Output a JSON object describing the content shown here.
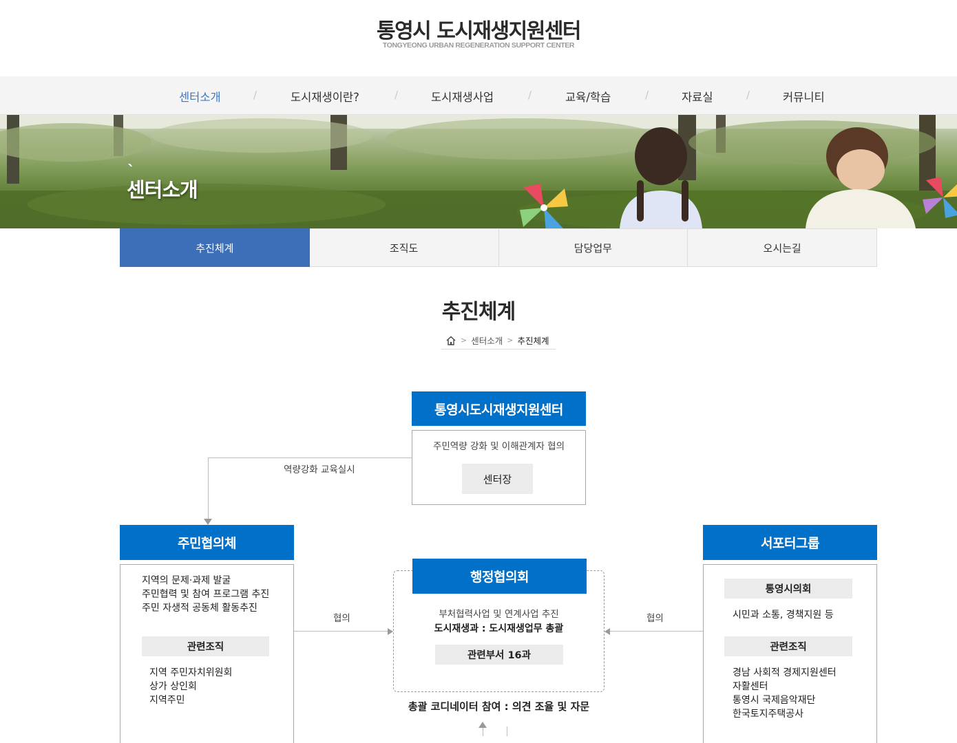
{
  "header": {
    "title": "통영시 도시재생지원센터",
    "subtitle": "TONGYEONG URBAN REGENERATION SUPPORT CENTER"
  },
  "gnb": {
    "items": [
      "센터소개",
      "도시재생이란?",
      "도시재생사업",
      "교육/학습",
      "자료실",
      "커뮤니티"
    ],
    "active_index": 0,
    "separator": "/",
    "active_color": "#3c79c4"
  },
  "banner": {
    "title": "센터소개",
    "tick": "`"
  },
  "subtabs": {
    "items": [
      "추진체계",
      "조직도",
      "담당업무",
      "오시는길"
    ],
    "active_index": 0,
    "active_color": "#3c6fb8"
  },
  "page": {
    "title": "추진체계",
    "breadcrumb": [
      "센터소개",
      "추진체계"
    ],
    "home_icon": "home-icon"
  },
  "diagram": {
    "box_color": "#0070c8",
    "center": {
      "title": "통영시도시재생지원센터",
      "description": "주민역량 강화 및 이해관계자 협의",
      "head": "센터장"
    },
    "edu_label": "역량강화 교육실시",
    "residents": {
      "title": "주민협의체",
      "lines": [
        "지역의 문제·과제 발굴",
        "주민협력 및 참여 프로그램 추진",
        "주민 자생적 공동체 활동추진"
      ],
      "related_label": "관련조직",
      "related": [
        "지역 주민자치위원회",
        "상가 상인회",
        "지역주민"
      ]
    },
    "admin": {
      "title": "행정협의회",
      "line1": "부처협력사업 및 연계사업 추진",
      "line2": "도시재생과 : 도시재생업무 총괄",
      "dept": "관련부서 16과"
    },
    "supporters": {
      "title": "서포터그룹",
      "council_label": "통영시의회",
      "council_desc": "시민과 소통, 경책지원 등",
      "related_label": "관련조직",
      "related": [
        "경남 사회적 경제지원센터",
        "자활센터",
        "통영시 국제음악재단",
        "한국토지주택공사"
      ]
    },
    "consult_left": "협의",
    "consult_right": "협의",
    "coordinator": "총괄 코디네이터 참여 : 의견 조율 및 자문"
  }
}
